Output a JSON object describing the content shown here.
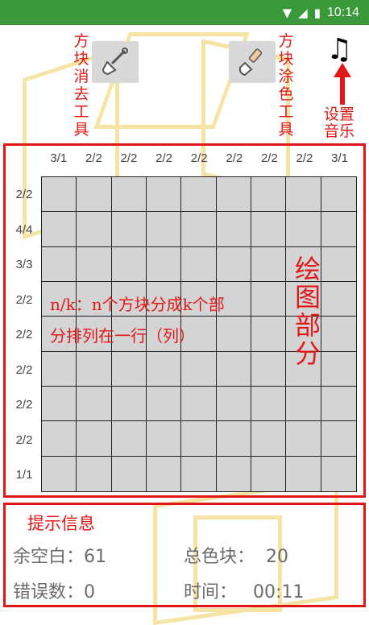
{
  "status_bar": {
    "time": "10:14",
    "battery_glyph": "▮",
    "signal_glyph": "◢",
    "wifi_glyph": "▼"
  },
  "tools": {
    "eraser_label": "方块消去工具",
    "paint_label": "方块涂色工具",
    "music_icon": "♫",
    "music_label": "设置音乐"
  },
  "puzzle": {
    "column_clues": [
      "3/1",
      "2/2",
      "2/2",
      "2/2",
      "2/2",
      "2/2",
      "2/2",
      "2/2",
      "3/1"
    ],
    "row_clues": [
      "2/2",
      "4/4",
      "3/3",
      "2/2",
      "2/2",
      "2/2",
      "2/2",
      "2/2",
      "1/1"
    ],
    "rows": 9,
    "cols": 9
  },
  "annotations": {
    "clue_line1": "n/k：n个方块分成k个部",
    "clue_line2": "分排列在一行（列）",
    "drawing_area": "绘图部分"
  },
  "info": {
    "hint_title": "提示信息",
    "remaining_label": "余空白：",
    "remaining_value": "61",
    "total_label": "总色块：",
    "total_value": "20",
    "errors_label": "错误数：",
    "errors_value": "0",
    "time_label": "时间：",
    "time_value": "00:11"
  },
  "colors": {
    "accent_red": "#e01818",
    "status_green": "#3a9a3a",
    "cell_gray": "#d4d4d4"
  }
}
